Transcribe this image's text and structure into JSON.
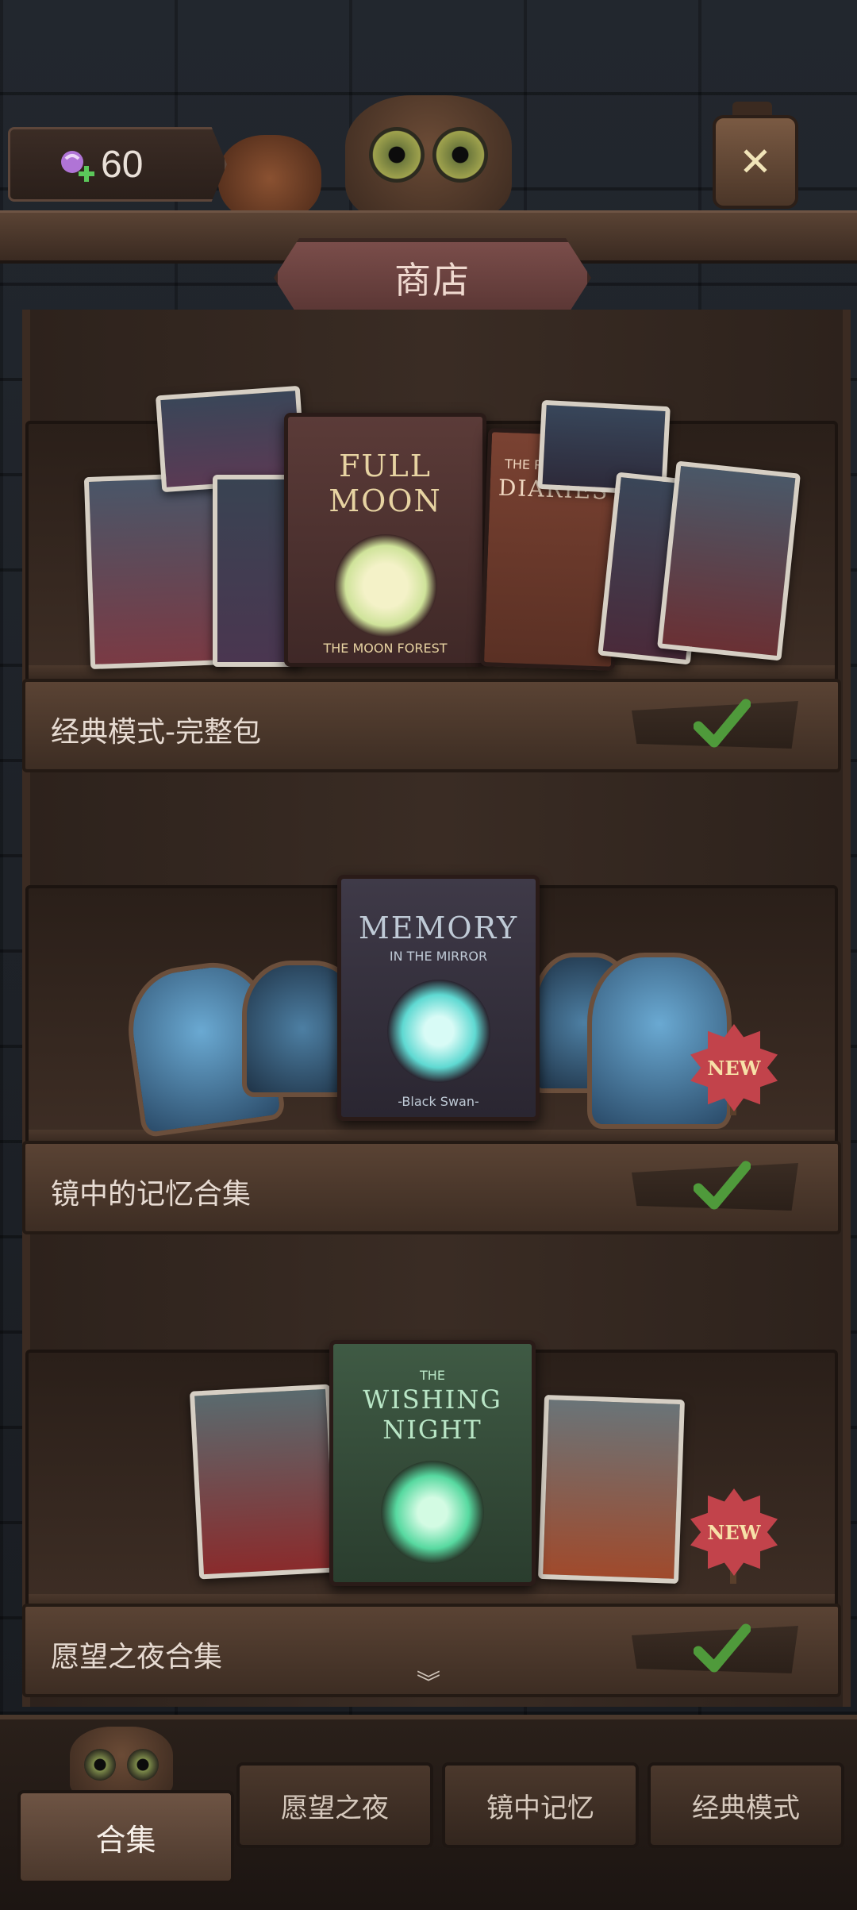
{
  "currency": {
    "value": "60",
    "icon": "candy-plus-icon"
  },
  "header": {
    "title": "商店"
  },
  "bundles": [
    {
      "label": "经典模式-完整包",
      "owned": true,
      "book_title": "FULL MOON",
      "book_sub": "THE MOON FOREST",
      "side_book_title": "DIARIES",
      "side_book_sub": "THE RED HOOD"
    },
    {
      "label": "镜中的记忆合集",
      "owned": true,
      "new": "NEW",
      "book_title": "MEMORY",
      "book_sub": "IN THE MIRROR",
      "book_author": "-Black Swan-"
    },
    {
      "label": "愿望之夜合集",
      "owned": true,
      "new": "NEW",
      "book_title": "WISHING NIGHT",
      "book_sub": "THE"
    }
  ],
  "tabs": [
    {
      "label": "合集",
      "active": true
    },
    {
      "label": "愿望之夜"
    },
    {
      "label": "镜中记忆"
    },
    {
      "label": "经典模式"
    }
  ],
  "colors": {
    "check": "#4f9a3b",
    "badge": "#c2434b",
    "plank": "#5a4334"
  }
}
